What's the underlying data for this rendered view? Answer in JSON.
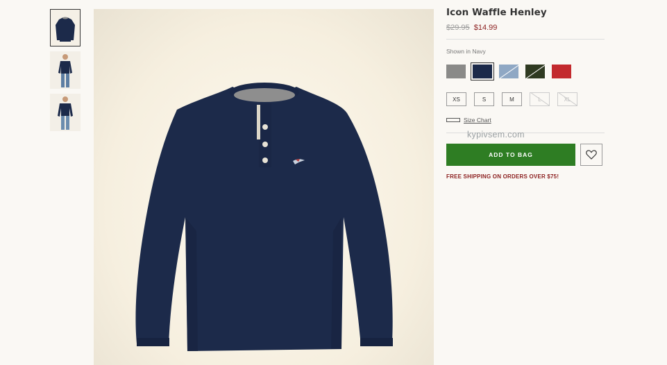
{
  "product": {
    "title": "Icon Waffle Henley",
    "old_price": "$29.95",
    "new_price": "$14.99",
    "shown_in": "Shown in Navy"
  },
  "thumbnails": [
    {
      "name": "front-flat",
      "active": true
    },
    {
      "name": "model-front",
      "active": false
    },
    {
      "name": "model-side",
      "active": false
    }
  ],
  "swatches": [
    {
      "name": "heather-grey",
      "color": "#8a8a88",
      "selected": false,
      "unavailable": false
    },
    {
      "name": "navy",
      "color": "#1c2a4a",
      "selected": true,
      "unavailable": false
    },
    {
      "name": "light-blue",
      "color": "#8fa8c4",
      "selected": false,
      "unavailable": true
    },
    {
      "name": "olive",
      "color": "#2f3a21",
      "selected": false,
      "unavailable": true
    },
    {
      "name": "red",
      "color": "#c32a2e",
      "selected": false,
      "unavailable": false
    }
  ],
  "sizes": [
    {
      "label": "XS",
      "available": true
    },
    {
      "label": "S",
      "available": true
    },
    {
      "label": "M",
      "available": true
    },
    {
      "label": "L",
      "available": false
    },
    {
      "label": "XL",
      "available": false
    }
  ],
  "size_chart_label": "Size Chart",
  "watermark": "kypivsem.com",
  "add_to_bag_label": "ADD TO BAG",
  "wishlist_icon": "heart-icon",
  "shipping_text": "FREE SHIPPING ON ORDERS OVER $75!",
  "colors": {
    "accent_green": "#2e7d23",
    "sale_red": "#8b1e1e",
    "shirt_navy": "#1c2a4a"
  }
}
